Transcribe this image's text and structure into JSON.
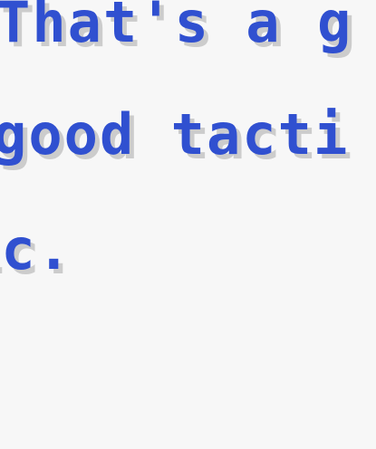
{
  "dialogue": {
    "lines": [
      "That's a g",
      "good tacti",
      "ic."
    ]
  },
  "colors": {
    "background": "#f7f7f7",
    "text": "#3050d0",
    "shadow": "#cccccc"
  }
}
